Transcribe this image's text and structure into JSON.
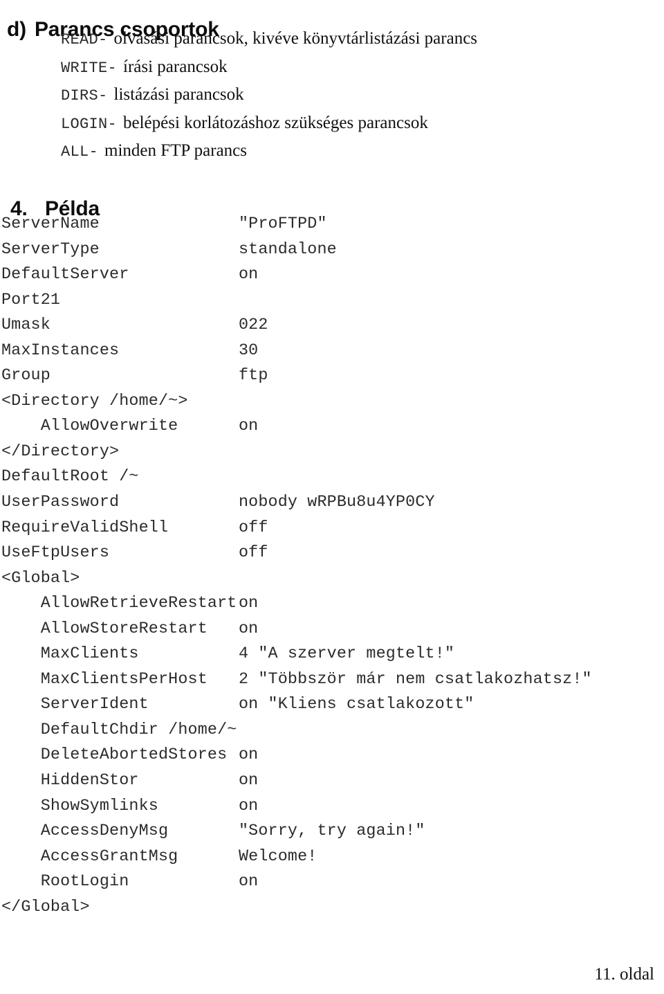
{
  "document": {
    "page_footer": "11. oldal"
  },
  "section_d": {
    "number": "d)",
    "title": "Parancs csoportok",
    "items": [
      {
        "key": "READ-",
        "desc": "olvasási parancsok, kivéve könyvtárlistázási parancs"
      },
      {
        "key": "WRITE-",
        "desc": "írási parancsok"
      },
      {
        "key": "DIRS-",
        "desc": "listázási parancsok"
      },
      {
        "key": "LOGIN-",
        "desc": "belépési korlátozáshoz szükséges parancsok"
      },
      {
        "key": "ALL-",
        "desc": "minden FTP parancs"
      }
    ]
  },
  "section_4": {
    "number": "4.",
    "title": "Példa",
    "config_lines": [
      {
        "key": "ServerName",
        "value": "\"ProFTPD\""
      },
      {
        "key": "ServerType",
        "value": "standalone"
      },
      {
        "key": "DefaultServer",
        "value": "on"
      },
      {
        "key": "Port21",
        "value": ""
      },
      {
        "key": "Umask",
        "value": "022"
      },
      {
        "key": "MaxInstances",
        "value": "30"
      },
      {
        "key": "Group",
        "value": "ftp"
      },
      {
        "key": "<Directory /home/~>",
        "value": ""
      },
      {
        "key": "    AllowOverwrite",
        "value": "on"
      },
      {
        "key": "</Directory>",
        "value": ""
      },
      {
        "key": "DefaultRoot /~",
        "value": ""
      },
      {
        "key": "UserPassword",
        "value": "nobody wRPBu8u4YP0CY"
      },
      {
        "key": "RequireValidShell",
        "value": "off"
      },
      {
        "key": "UseFtpUsers",
        "value": "off"
      },
      {
        "key": "<Global>",
        "value": ""
      },
      {
        "key": "    AllowRetrieveRestart",
        "value": "on"
      },
      {
        "key": "    AllowStoreRestart",
        "value": "on"
      },
      {
        "key": "    MaxClients",
        "value": "4 \"A szerver megtelt!\""
      },
      {
        "key": "    MaxClientsPerHost",
        "value": "2 \"Többször már nem csatlakozhatsz!\""
      },
      {
        "key": "    ServerIdent",
        "value": "on \"Kliens csatlakozott\""
      },
      {
        "key": "    DefaultChdir /home/~",
        "value": ""
      },
      {
        "key": "    DeleteAbortedStores",
        "value": "on"
      },
      {
        "key": "    HiddenStor",
        "value": "on"
      },
      {
        "key": "    ShowSymlinks",
        "value": "on"
      },
      {
        "key": "    AccessDenyMsg",
        "value": "\"Sorry, try again!\""
      },
      {
        "key": "    AccessGrantMsg",
        "value": "Welcome!"
      },
      {
        "key": "    RootLogin",
        "value": "on"
      },
      {
        "key": "</Global>",
        "value": ""
      }
    ]
  }
}
